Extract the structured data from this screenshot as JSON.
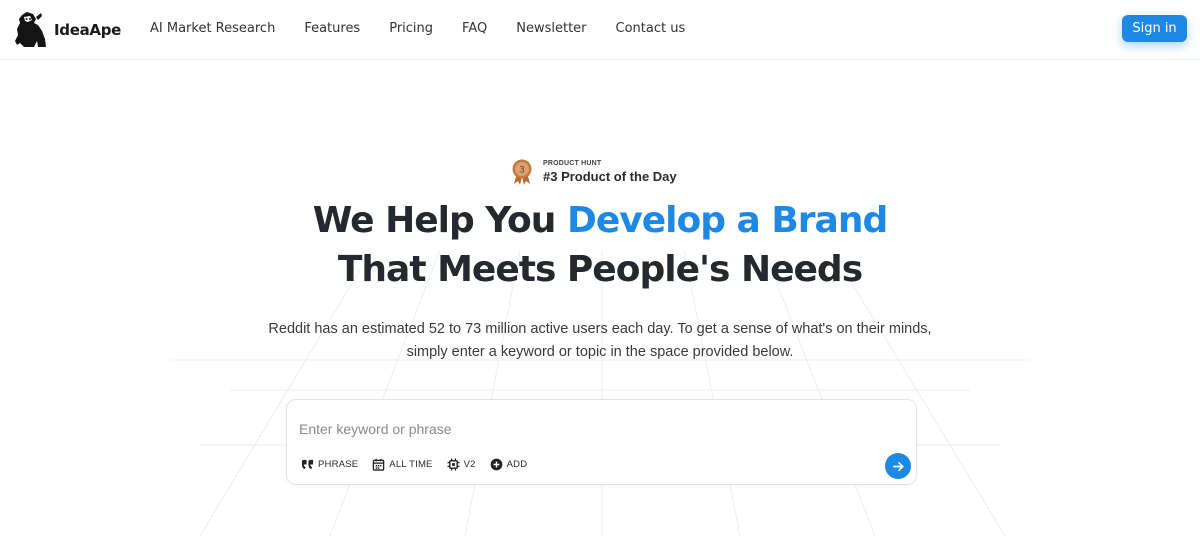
{
  "brand": {
    "name": "IdeaApe"
  },
  "nav": {
    "items": [
      {
        "label": "AI Market Research"
      },
      {
        "label": "Features"
      },
      {
        "label": "Pricing"
      },
      {
        "label": "FAQ"
      },
      {
        "label": "Newsletter"
      },
      {
        "label": "Contact us"
      }
    ]
  },
  "header": {
    "signin_label": "Sign in"
  },
  "badge": {
    "medal_number": "3",
    "small_label": "PRODUCT HUNT",
    "big_label": "#3 Product of the Day"
  },
  "hero": {
    "line1_prefix": "We Help You ",
    "line1_accent": "Develop a Brand",
    "line2": "That Meets People's Needs",
    "subtitle": "Reddit has an estimated 52 to 73 million active users each day. To get a sense of what's on their minds, simply enter a keyword or topic in the space provided below."
  },
  "search": {
    "placeholder": "Enter keyword or phrase",
    "value": "",
    "tools": [
      {
        "label": "PHRASE",
        "icon": "quote-icon"
      },
      {
        "label": "ALL TIME",
        "icon": "calendar-icon"
      },
      {
        "label": "V2",
        "icon": "chip-icon"
      },
      {
        "label": "ADD",
        "icon": "plus-circle-icon"
      }
    ],
    "submit_icon": "arrow-right-icon"
  },
  "colors": {
    "accent": "#1e88e5",
    "heading": "#25282c",
    "medal": "#c57a3c"
  }
}
